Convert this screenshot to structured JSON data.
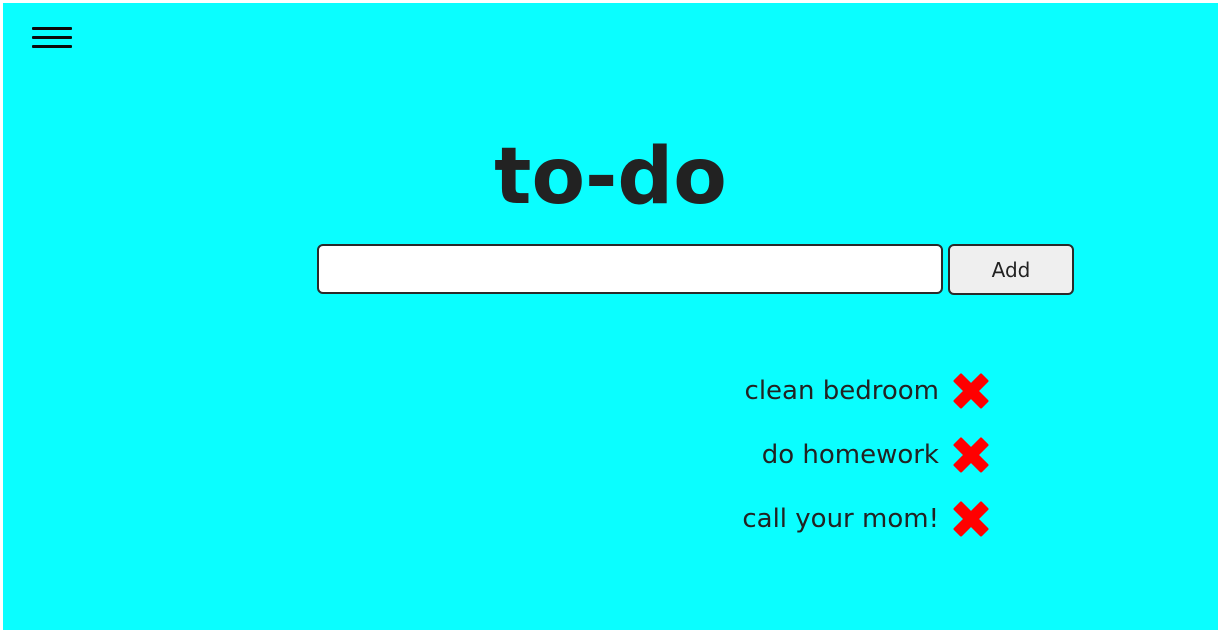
{
  "page": {
    "title": "to-do",
    "background_color": "#0afeff"
  },
  "header": {
    "menu_icon": "hamburger-menu-icon"
  },
  "form": {
    "input_value": "",
    "input_placeholder": "",
    "add_label": "Add"
  },
  "todos": [
    {
      "text": "clean bedroom",
      "delete_icon": "red-x-icon"
    },
    {
      "text": "do homework",
      "delete_icon": "red-x-icon"
    },
    {
      "text": "call your mom!",
      "delete_icon": "red-x-icon"
    }
  ],
  "colors": {
    "delete_icon": "#ff0000",
    "text": "#222222"
  }
}
